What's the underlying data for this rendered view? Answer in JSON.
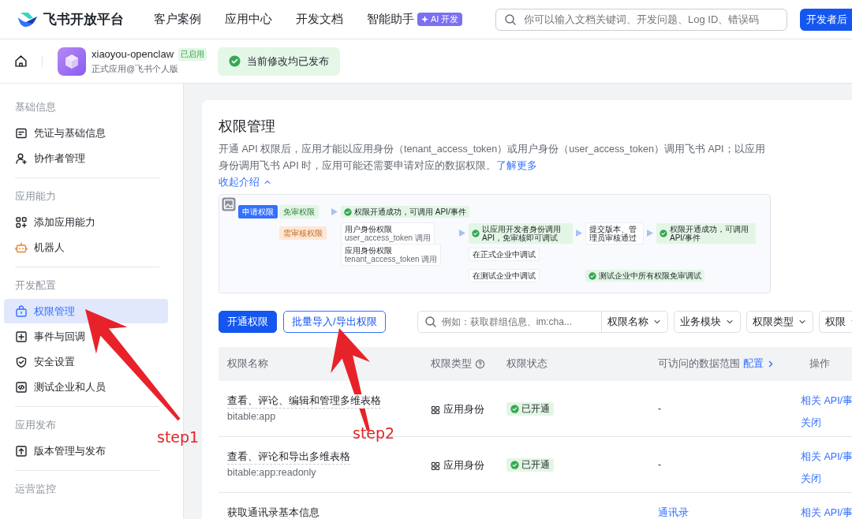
{
  "nav": {
    "logo_text": "飞书开放平台",
    "items": [
      "客户案例",
      "应用中心",
      "开发文档",
      "智能助手"
    ],
    "ai_badge": "AI 开发",
    "search": {
      "placeholder": "你可以输入文档关键词、开发问题、Log ID、错误码"
    },
    "console_button": "开发者后"
  },
  "app_bar": {
    "name": "xiaoyou-openclaw",
    "tag": "已启用",
    "subtitle": "正式应用@飞书个人版",
    "notice": "当前修改均已发布"
  },
  "sidebar": {
    "groups": [
      {
        "title": "基础信息",
        "items": [
          {
            "label": "凭证与基础信息",
            "selected": false
          },
          {
            "label": "协作者管理",
            "selected": false
          }
        ]
      },
      {
        "title": "应用能力",
        "items": [
          {
            "label": "添加应用能力",
            "selected": false
          },
          {
            "label": "机器人",
            "selected": false
          }
        ]
      },
      {
        "title": "开发配置",
        "items": [
          {
            "label": "权限管理",
            "selected": true
          },
          {
            "label": "事件与回调",
            "selected": false
          },
          {
            "label": "安全设置",
            "selected": false
          },
          {
            "label": "测试企业和人员",
            "selected": false
          }
        ]
      },
      {
        "title": "应用发布",
        "items": [
          {
            "label": "版本管理与发布",
            "selected": false
          }
        ]
      },
      {
        "title": "运营监控"
      }
    ]
  },
  "page": {
    "title": "权限管理",
    "description": "开通 API 权限后，应用才能以应用身份（tenant_access_token）或用户身份（user_access_token）调用飞书 API；以应用身份调用飞书 API 时，应用可能还需要申请对应的数据权限。",
    "learn_more": "了解更多",
    "collapse": "收起介绍",
    "diagram": {
      "nodes": [
        {
          "kind": "start",
          "label": "申请权限"
        },
        {
          "kind": "free",
          "label": "免审权限"
        },
        {
          "kind": "success",
          "label": "权限开通成功，可调用 API/事件"
        },
        {
          "kind": "review",
          "label": "需审核权限"
        },
        {
          "kind": "plain",
          "label": "用户身份权限",
          "note": "user_access_token 调用"
        },
        {
          "kind": "success",
          "label": "以应用开发者身份调用 API，免审核即可调试"
        },
        {
          "kind": "plain",
          "label": "提交版本、管理员审核通过"
        },
        {
          "kind": "success",
          "label": "权限开通成功，可调用 API/事件"
        },
        {
          "kind": "plain",
          "label": "应用身份权限",
          "note": "tenant_access_token 调用"
        },
        {
          "kind": "plain",
          "label": "在正式企业中调试"
        },
        {
          "kind": "plain",
          "label": "在测试企业中调试"
        },
        {
          "kind": "success",
          "label": "测试企业中所有权限免审调试"
        }
      ]
    },
    "buttons": [
      {
        "label": "开通权限",
        "kind": "primary"
      },
      {
        "label": "批量导入/导出权限",
        "kind": "outline"
      }
    ],
    "filter": {
      "placeholder": "例如：获取群组信息、im:cha...",
      "dropdowns": [
        "权限名称",
        "业务模块",
        "权限类型",
        "权限"
      ]
    },
    "table": {
      "columns": [
        "权限名称",
        "权限类型",
        "权限状态",
        "可访问的数据范围",
        "操作"
      ],
      "scope_link": "配置",
      "rows": [
        {
          "name": "查看、评论、编辑和管理多维表格",
          "code": "bitable:app",
          "type": "应用身份",
          "status": "已开通",
          "scope": {
            "text": "-",
            "link": false
          },
          "actions": [
            "相关 API/事",
            "关闭"
          ]
        },
        {
          "name": "查看、评论和导出多维表格",
          "code": "bitable:app:readonly",
          "type": "应用身份",
          "status": "已开通",
          "scope": {
            "text": "-",
            "link": false
          },
          "actions": [
            "相关 API/事",
            "关闭"
          ]
        },
        {
          "name": "获取通讯录基本信息",
          "scope": {
            "text": "通讯录",
            "link": true
          },
          "actions": [
            "相关 API/事"
          ]
        }
      ]
    }
  },
  "annotations": [
    {
      "label": "step1"
    },
    {
      "label": "step2"
    }
  ]
}
